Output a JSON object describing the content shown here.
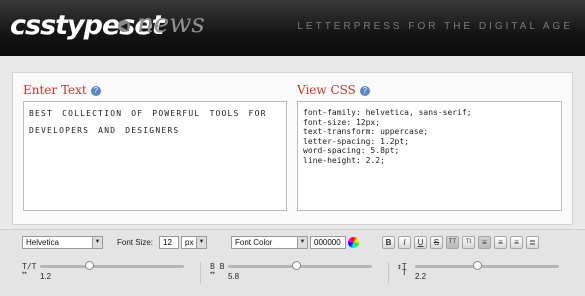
{
  "header": {
    "logo_text": "csstypeset",
    "back_icon": "back-arrow-icon",
    "section": "news",
    "tagline": "LETTERPRESS FOR THE DIGITAL AGE"
  },
  "enter": {
    "title": "Enter Text",
    "help_icon": "?",
    "text": "BEST COLLECTION OF POWERFUL TOOLS FOR DEVELOPERS AND DESIGNERS"
  },
  "view": {
    "title": "View CSS",
    "help_icon": "?",
    "css": "font-family: helvetica, sans-serif;\nfont-size: 12px;\ntext-transform: uppercase;\nletter-spacing: 1.2pt;\nword-spacing: 5.8pt;\nline-height: 2.2;"
  },
  "toolbar": {
    "font_family": "Helvetica",
    "font_size_label": "Font Size:",
    "font_size": "12",
    "font_unit": "px",
    "font_color_label": "Font Color",
    "color_hex": "000000",
    "format_buttons": [
      "B",
      "I",
      "U",
      "S",
      "TT",
      "Tt",
      "left",
      "center",
      "right",
      "justify"
    ]
  },
  "sliders": {
    "letter_spacing": {
      "icon": "letter-spacing-icon",
      "value": "1.2",
      "level": 0.34
    },
    "word_spacing": {
      "icon": "word-spacing-icon",
      "value": "5.8",
      "level": 0.47
    },
    "line_height": {
      "icon": "line-height-icon",
      "value": "2.2",
      "level": 0.43
    }
  }
}
